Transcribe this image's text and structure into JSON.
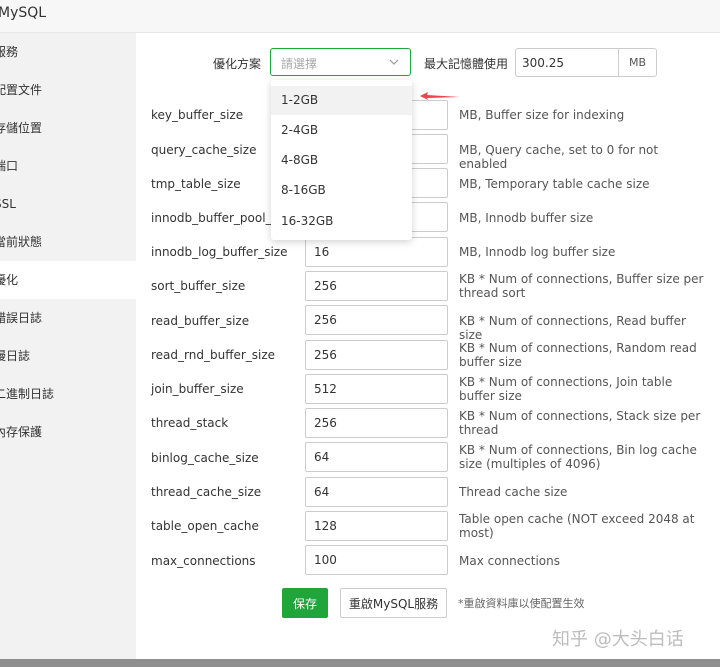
{
  "window": {
    "title": "MySQL"
  },
  "sidebar": {
    "items": [
      {
        "label": "服務"
      },
      {
        "label": "配置文件"
      },
      {
        "label": "存儲位置"
      },
      {
        "label": "端口"
      },
      {
        "label": "SSL"
      },
      {
        "label": "當前狀態"
      },
      {
        "label": "優化"
      },
      {
        "label": "錯誤日誌"
      },
      {
        "label": "慢日誌"
      },
      {
        "label": "二進制日誌"
      },
      {
        "label": "內存保護"
      }
    ],
    "active_index": 6
  },
  "optimize": {
    "scheme_label": "優化方案",
    "scheme_placeholder": "請選擇",
    "max_mem_label": "最大記憶體使用",
    "max_mem_value": "300.25",
    "max_mem_unit": "MB",
    "options": [
      "1-2GB",
      "2-4GB",
      "4-8GB",
      "8-16GB",
      "16-32GB"
    ],
    "hovered_option": "1-2GB"
  },
  "params": [
    {
      "name": "key_buffer_size",
      "value": "",
      "desc": "MB, Buffer size for indexing"
    },
    {
      "name": "query_cache_size",
      "value": "",
      "desc": "MB, Query cache, set to 0 for not enabled"
    },
    {
      "name": "tmp_table_size",
      "value": "",
      "desc": "MB, Temporary table cache size"
    },
    {
      "name": "innodb_buffer_pool_size",
      "value": "",
      "desc": "MB, Innodb buffer size"
    },
    {
      "name": "innodb_log_buffer_size",
      "value": "16",
      "desc": "MB, Innodb log buffer size"
    },
    {
      "name": "sort_buffer_size",
      "value": "256",
      "desc": "KB * Num of connections, Buffer size per thread sort"
    },
    {
      "name": "read_buffer_size",
      "value": "256",
      "desc": "KB * Num of connections, Read buffer size"
    },
    {
      "name": "read_rnd_buffer_size",
      "value": "256",
      "desc": "KB * Num of connections, Random read buffer size"
    },
    {
      "name": "join_buffer_size",
      "value": "512",
      "desc": "KB * Num of connections, Join table buffer size"
    },
    {
      "name": "thread_stack",
      "value": "256",
      "desc": "KB * Num of connections, Stack size per thread"
    },
    {
      "name": "binlog_cache_size",
      "value": "64",
      "desc": "KB * Num of connections, Bin log cache size (multiples of 4096)"
    },
    {
      "name": "thread_cache_size",
      "value": "64",
      "desc": "Thread cache size"
    },
    {
      "name": "table_open_cache",
      "value": "128",
      "desc": "Table open cache (NOT exceed 2048 at most)"
    },
    {
      "name": "max_connections",
      "value": "100",
      "desc": "Max connections"
    }
  ],
  "actions": {
    "save_label": "保存",
    "restart_label": "重啟MySQL服務",
    "note": "*重啟資料庫以使配置生效"
  },
  "watermark": "知乎 @大头白话",
  "colors": {
    "accent": "#20a53a",
    "arrow": "#e8464e",
    "sidebar_bg": "#f2f2f2"
  }
}
